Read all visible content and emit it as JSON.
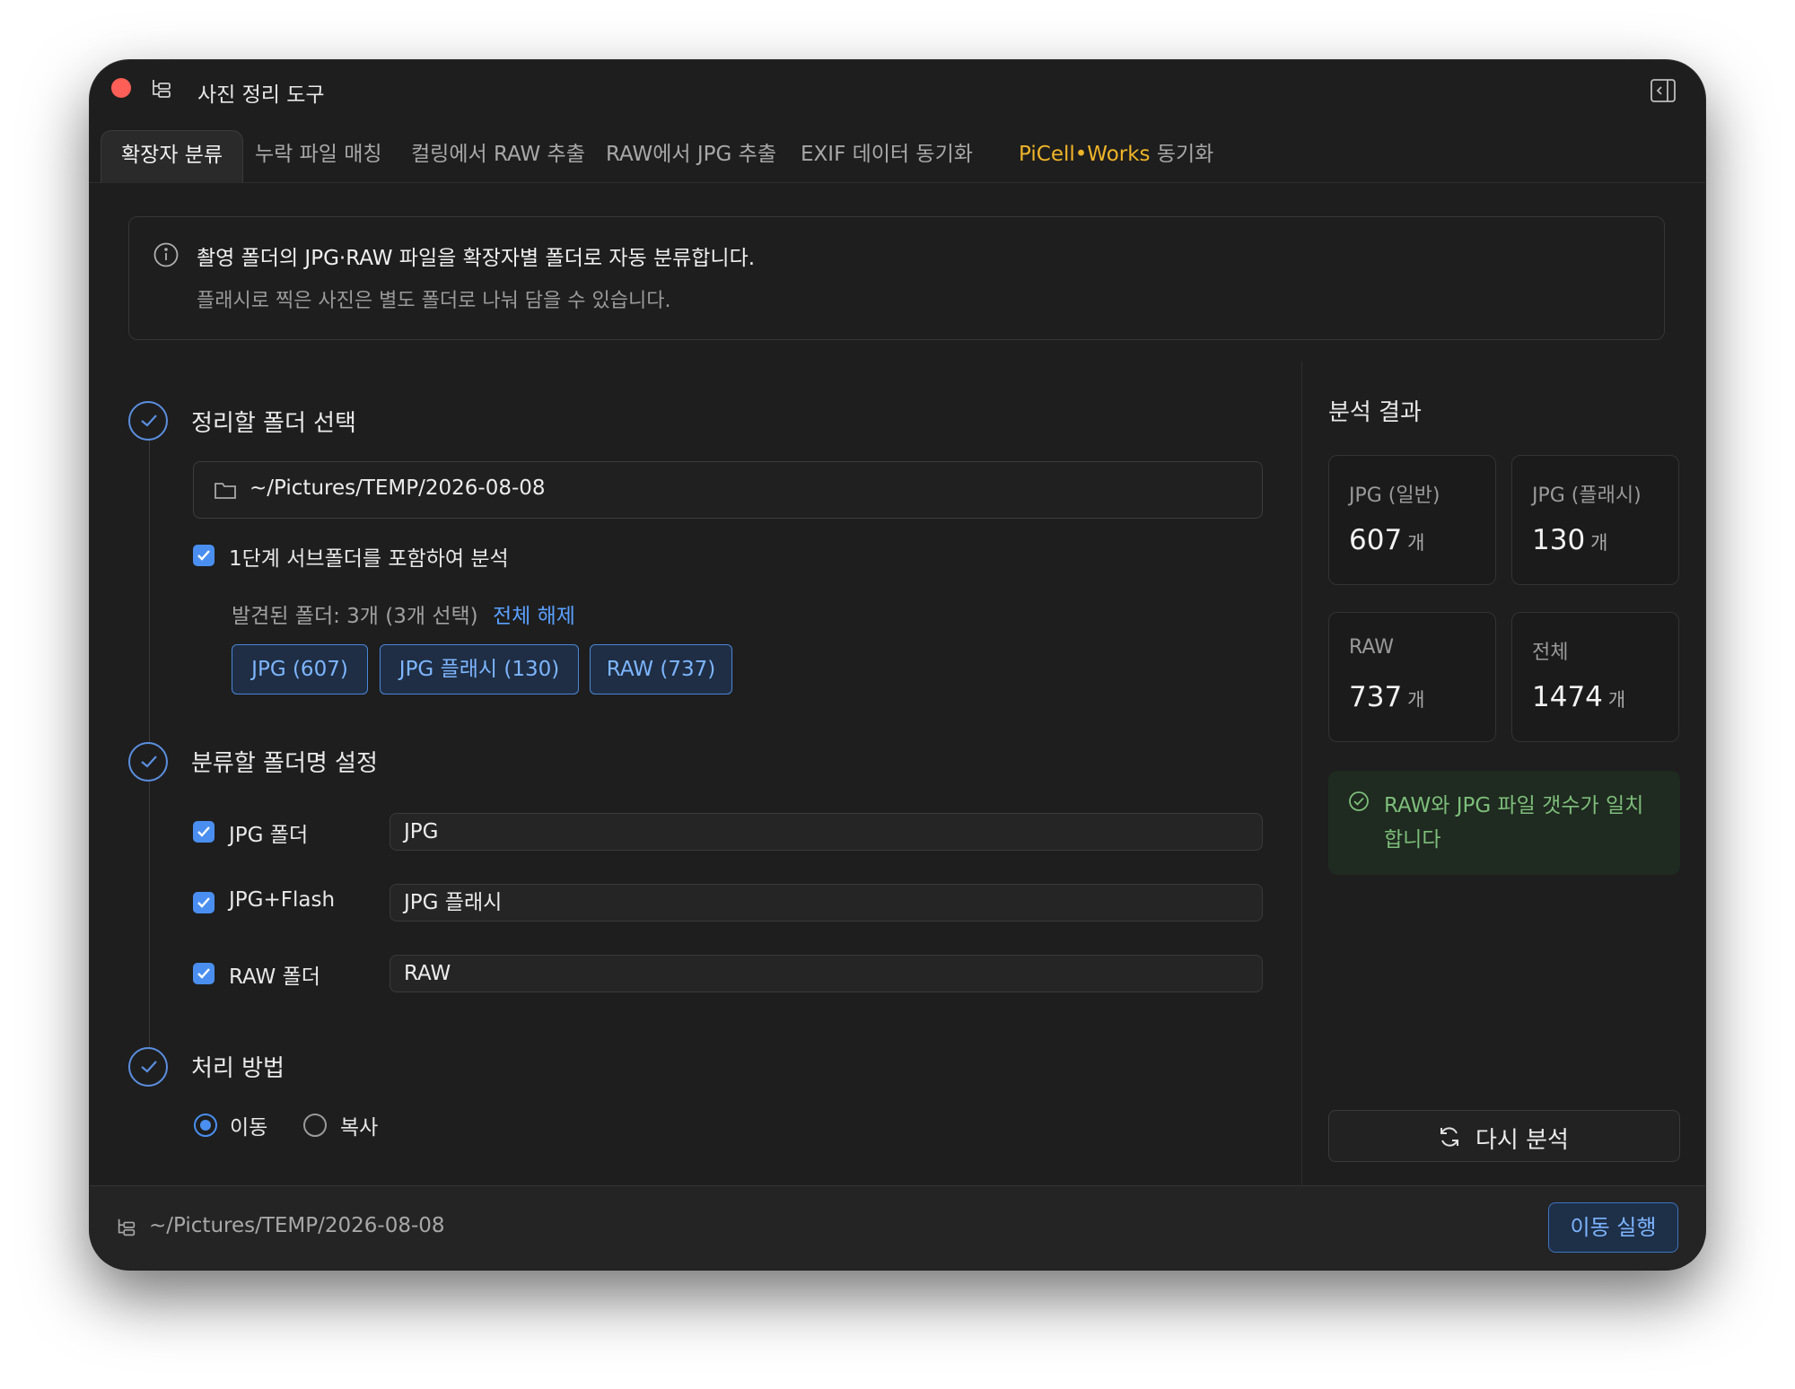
{
  "app": {
    "title": "사진 정리 도구"
  },
  "tabs": [
    {
      "label": "확장자 분류",
      "active": true
    },
    {
      "label": "누락 파일 매칭"
    },
    {
      "label": "컬링에서 RAW 추출"
    },
    {
      "label": "RAW에서 JPG 추출"
    },
    {
      "label": "EXIF 데이터 동기화"
    },
    {
      "brand": "PiCell•Works",
      "label": "동기화"
    }
  ],
  "info": {
    "line1": "촬영 폴더의 JPG·RAW 파일을 확장자별 폴더로 자동 분류합니다.",
    "line2": "플래시로 찍은 사진은 별도 폴더로 나눠 담을 수 있습니다."
  },
  "step1": {
    "title": "정리할 폴더 선택",
    "folder_path": "~/Pictures/TEMP/2026-08-08",
    "include_subfolders_label": "1단계 서브폴더를 포함하여 분석",
    "include_subfolders_checked": true,
    "found_folders": "발견된 폴더: 3개 (3개 선택)",
    "deselect_all": "전체 해제",
    "chips": [
      "JPG (607)",
      "JPG 플래시 (130)",
      "RAW (737)"
    ]
  },
  "step2": {
    "title": "분류할 폴더명 설정",
    "rows": [
      {
        "label": "JPG 폴더",
        "value": "JPG",
        "checked": true
      },
      {
        "label": "JPG+Flash",
        "value": "JPG 플래시",
        "checked": true
      },
      {
        "label": "RAW 폴더",
        "value": "RAW",
        "checked": true
      }
    ]
  },
  "step3": {
    "title": "처리 방법",
    "options": [
      {
        "label": "이동",
        "selected": true
      },
      {
        "label": "복사",
        "selected": false
      }
    ]
  },
  "results": {
    "title": "분석 결과",
    "unit": "개",
    "stats": [
      {
        "label": "JPG (일반)",
        "value": "607"
      },
      {
        "label": "JPG (플래시)",
        "value": "130"
      },
      {
        "label": "RAW",
        "value": "737"
      },
      {
        "label": "전체",
        "value": "1474"
      }
    ],
    "match_message": "RAW와 JPG 파일 갯수가 일치합니다",
    "reanalyze_label": "다시 분석"
  },
  "footer": {
    "path": "~/Pictures/TEMP/2026-08-08",
    "run_label": "이동 실행"
  },
  "colors": {
    "accent": "#4a8ff0",
    "close": "#ff5f57",
    "brand": "#f0b429",
    "success": "#7dbe7a",
    "background": "#1e1e1e"
  }
}
